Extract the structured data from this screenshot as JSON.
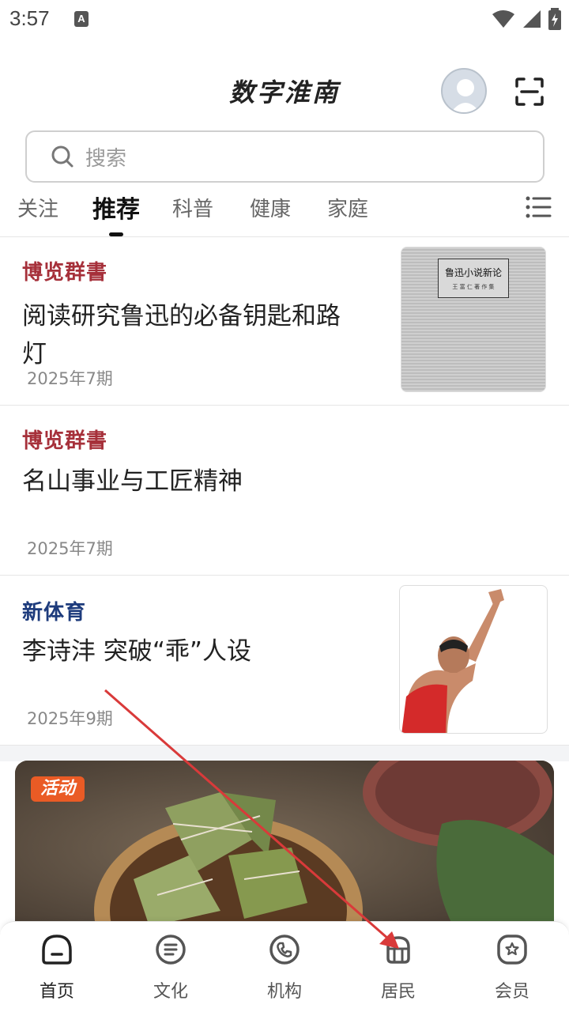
{
  "status_bar": {
    "time": "3:57",
    "notif_icon": "A"
  },
  "header": {
    "title": "数字淮南"
  },
  "search": {
    "placeholder": "搜索"
  },
  "tabs": [
    {
      "label": "关注"
    },
    {
      "label": "推荐",
      "active": true
    },
    {
      "label": "科普"
    },
    {
      "label": "健康"
    },
    {
      "label": "家庭"
    }
  ],
  "articles": [
    {
      "source": "博览群書",
      "title_line1": "阅读研究鲁迅的必备钥匙和路",
      "title_line2": "灯",
      "date": "2025年7期",
      "thumb_text": "鲁迅小说新论",
      "thumb_subtext": "王 富 仁 著 作 集"
    },
    {
      "source": "博览群書",
      "title_line1": "名山事业与工匠精神",
      "date": "2025年7期"
    },
    {
      "source": "新体育",
      "title_line1": "李诗沣 突破“乖”人设",
      "date": "2025年9期"
    }
  ],
  "banner": {
    "tag": "活动"
  },
  "bottom_nav": [
    {
      "label": "首页",
      "icon": "home-icon",
      "active": true
    },
    {
      "label": "文化",
      "icon": "culture-icon"
    },
    {
      "label": "机构",
      "icon": "phone-icon"
    },
    {
      "label": "居民",
      "icon": "resident-icon"
    },
    {
      "label": "会员",
      "icon": "member-icon"
    }
  ],
  "colors": {
    "source_red": "#a6303a",
    "source_blue": "#1d3b7c",
    "annotation_arrow": "#d93a3a",
    "banner_tag": "#ea5b25"
  }
}
